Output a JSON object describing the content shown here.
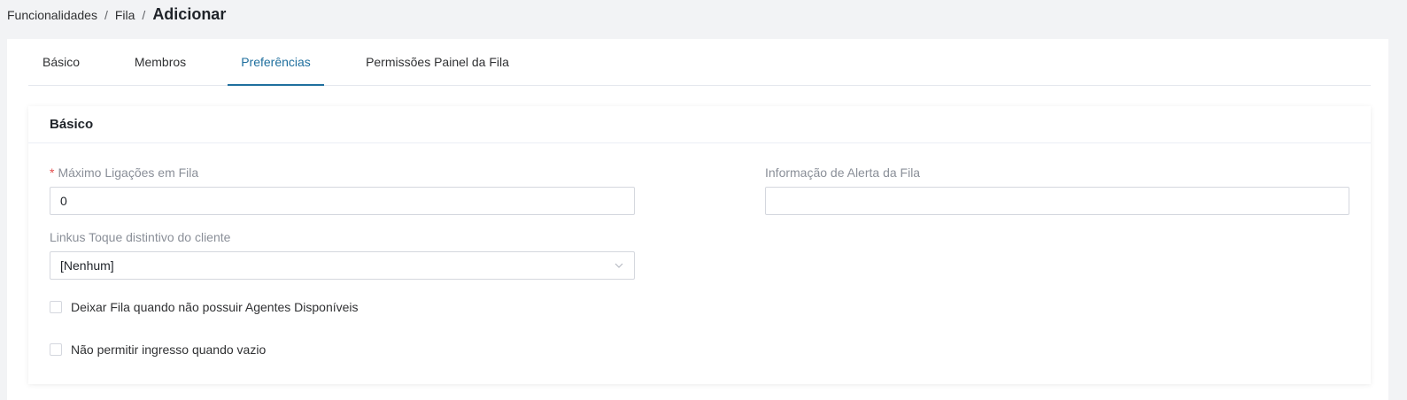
{
  "breadcrumb": {
    "items": [
      "Funcionalidades",
      "Fila"
    ],
    "separator": "/",
    "current": "Adicionar"
  },
  "tabs": [
    {
      "label": "Básico",
      "active": false
    },
    {
      "label": "Membros",
      "active": false
    },
    {
      "label": "Preferências",
      "active": true
    },
    {
      "label": "Permissões Painel da Fila",
      "active": false
    }
  ],
  "card": {
    "title": "Básico",
    "fields": {
      "max_calls": {
        "required_mark": "*",
        "label": "Máximo Ligações em Fila",
        "value": "0"
      },
      "alert_info": {
        "label": "Informação de Alerta da Fila",
        "value": ""
      },
      "ringtone": {
        "label": "Linkus Toque distintivo do cliente",
        "selected": "[Nenhum]"
      }
    },
    "checkboxes": [
      {
        "label": "Deixar Fila quando não possuir Agentes Disponíveis",
        "checked": false
      },
      {
        "label": "Não permitir ingresso quando vazio",
        "checked": false
      }
    ]
  },
  "colors": {
    "accent": "#1f6f9e",
    "required": "#e34d4d",
    "background": "#f2f3f5"
  }
}
